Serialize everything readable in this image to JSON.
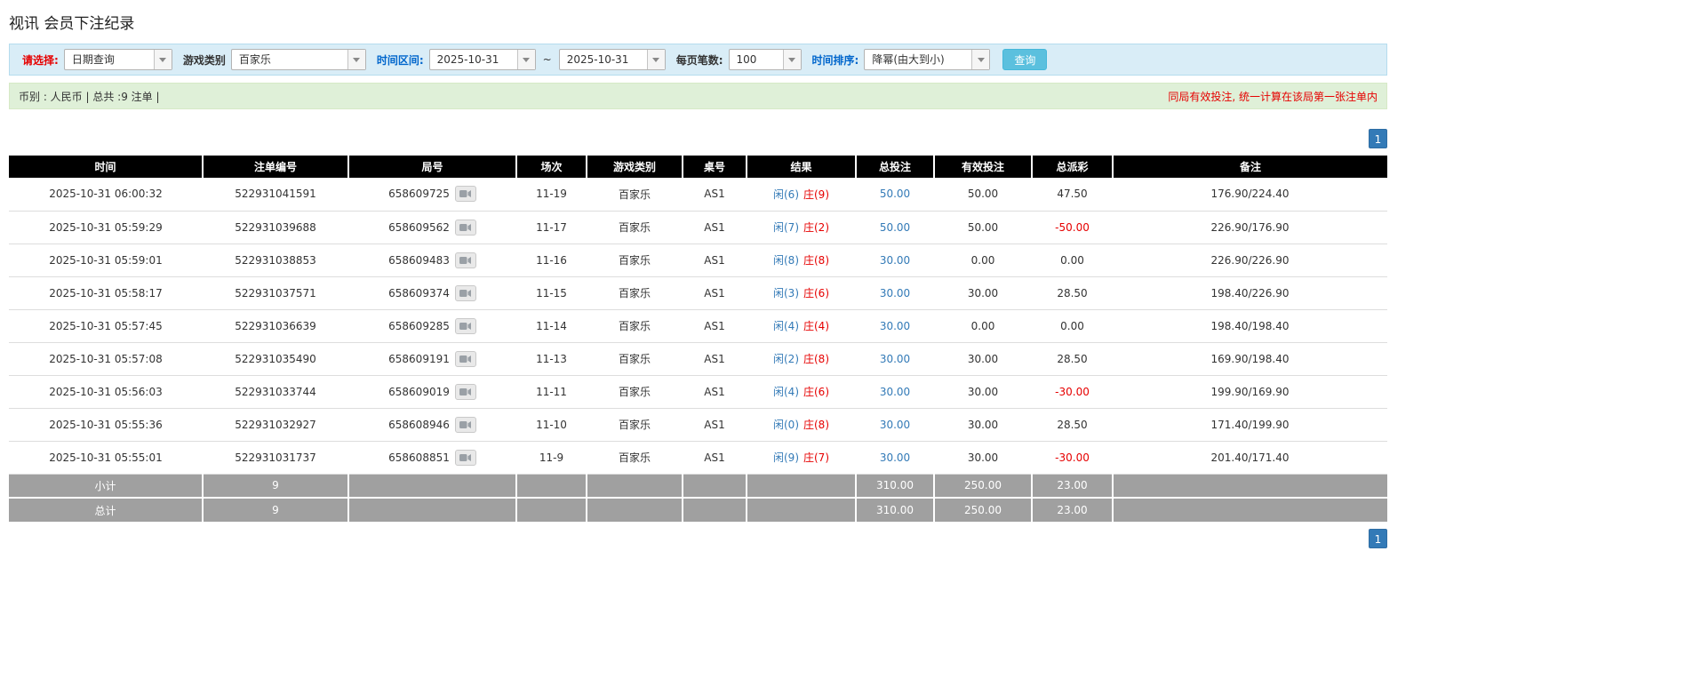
{
  "page_title": "视讯 会员下注纪录",
  "filter_bar": {
    "select_label": "请选择:",
    "select_value": "日期查询",
    "game_type_label": "游戏类别",
    "game_type_value": "百家乐",
    "date_range_label": "时间区间:",
    "date_from": "2025-10-31",
    "range_separator": "~",
    "date_to": "2025-10-31",
    "page_size_label": "每页笔数:",
    "page_size_value": "100",
    "sort_label": "时间排序:",
    "sort_value": "降幂(由大到小)",
    "search_button_label": "查询"
  },
  "info_bar": {
    "summary": "币别 : 人民币 | 总共 :9 注单 |",
    "notice": "同局有效投注, 统一计算在该局第一张注单内"
  },
  "pagination": {
    "current_page": "1"
  },
  "table": {
    "headers": [
      "时间",
      "注单编号",
      "局号",
      "场次",
      "游戏类别",
      "桌号",
      "结果",
      "总投注",
      "有效投注",
      "总派彩",
      "备注"
    ],
    "rows": [
      {
        "time": "2025-10-31 06:00:32",
        "bet_id": "522931041591",
        "round_id": "658609725",
        "session": "11-19",
        "game": "百家乐",
        "table_no": "AS1",
        "result_player": "闲(6)",
        "result_banker": "庄(9)",
        "total_bet": "50.00",
        "valid_bet": "50.00",
        "payout": "47.50",
        "note": "176.90/224.40"
      },
      {
        "time": "2025-10-31 05:59:29",
        "bet_id": "522931039688",
        "round_id": "658609562",
        "session": "11-17",
        "game": "百家乐",
        "table_no": "AS1",
        "result_player": "闲(7)",
        "result_banker": "庄(2)",
        "total_bet": "50.00",
        "valid_bet": "50.00",
        "payout": "-50.00",
        "note": "226.90/176.90"
      },
      {
        "time": "2025-10-31 05:59:01",
        "bet_id": "522931038853",
        "round_id": "658609483",
        "session": "11-16",
        "game": "百家乐",
        "table_no": "AS1",
        "result_player": "闲(8)",
        "result_banker": "庄(8)",
        "total_bet": "30.00",
        "valid_bet": "0.00",
        "payout": "0.00",
        "note": "226.90/226.90"
      },
      {
        "time": "2025-10-31 05:58:17",
        "bet_id": "522931037571",
        "round_id": "658609374",
        "session": "11-15",
        "game": "百家乐",
        "table_no": "AS1",
        "result_player": "闲(3)",
        "result_banker": "庄(6)",
        "total_bet": "30.00",
        "valid_bet": "30.00",
        "payout": "28.50",
        "note": "198.40/226.90"
      },
      {
        "time": "2025-10-31 05:57:45",
        "bet_id": "522931036639",
        "round_id": "658609285",
        "session": "11-14",
        "game": "百家乐",
        "table_no": "AS1",
        "result_player": "闲(4)",
        "result_banker": "庄(4)",
        "total_bet": "30.00",
        "valid_bet": "0.00",
        "payout": "0.00",
        "note": "198.40/198.40"
      },
      {
        "time": "2025-10-31 05:57:08",
        "bet_id": "522931035490",
        "round_id": "658609191",
        "session": "11-13",
        "game": "百家乐",
        "table_no": "AS1",
        "result_player": "闲(2)",
        "result_banker": "庄(8)",
        "total_bet": "30.00",
        "valid_bet": "30.00",
        "payout": "28.50",
        "note": "169.90/198.40"
      },
      {
        "time": "2025-10-31 05:56:03",
        "bet_id": "522931033744",
        "round_id": "658609019",
        "session": "11-11",
        "game": "百家乐",
        "table_no": "AS1",
        "result_player": "闲(4)",
        "result_banker": "庄(6)",
        "total_bet": "30.00",
        "valid_bet": "30.00",
        "payout": "-30.00",
        "note": "199.90/169.90"
      },
      {
        "time": "2025-10-31 05:55:36",
        "bet_id": "522931032927",
        "round_id": "658608946",
        "session": "11-10",
        "game": "百家乐",
        "table_no": "AS1",
        "result_player": "闲(0)",
        "result_banker": "庄(8)",
        "total_bet": "30.00",
        "valid_bet": "30.00",
        "payout": "28.50",
        "note": "171.40/199.90"
      },
      {
        "time": "2025-10-31 05:55:01",
        "bet_id": "522931031737",
        "round_id": "658608851",
        "session": "11-9",
        "game": "百家乐",
        "table_no": "AS1",
        "result_player": "闲(9)",
        "result_banker": "庄(7)",
        "total_bet": "30.00",
        "valid_bet": "30.00",
        "payout": "-30.00",
        "note": "201.40/171.40"
      }
    ],
    "subtotal_row": {
      "label": "小计",
      "count": "9",
      "total_bet": "310.00",
      "valid_bet": "250.00",
      "payout": "23.00"
    },
    "total_row": {
      "label": "总计",
      "count": "9",
      "total_bet": "310.00",
      "valid_bet": "250.00",
      "payout": "23.00"
    }
  },
  "icons": {
    "dropdown_arrow": "chevron-down-icon",
    "video_button": "video-camera-icon"
  },
  "colors": {
    "link_blue": "#337ab7",
    "negative_red": "#e60000",
    "result_player_blue": "#337ab7",
    "result_banker_red": "#e60000",
    "header_bg": "#000000",
    "footer_bg": "#a0a0a0",
    "filter_bar_bg": "#d9edf7",
    "info_bar_bg": "#dff0d8",
    "search_button_bg": "#5bc0de",
    "pagination_bg": "#337ab7"
  }
}
